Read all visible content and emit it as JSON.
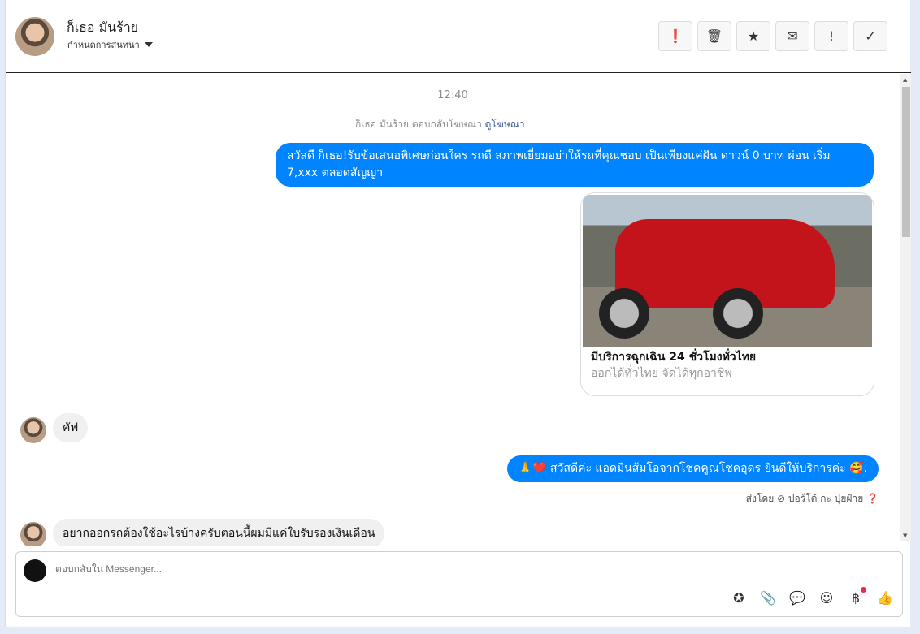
{
  "header": {
    "name": "ก็เธอ มันร้าย",
    "subtitle": "กำหนดการสนทนา",
    "actions": [
      {
        "icon": "alert-circle-icon",
        "glyph": "❗"
      },
      {
        "icon": "trash-icon",
        "glyph": "🗑"
      },
      {
        "icon": "star-icon",
        "glyph": "★"
      },
      {
        "icon": "mail-icon",
        "glyph": "✉"
      },
      {
        "icon": "exclamation-icon",
        "glyph": "!"
      },
      {
        "icon": "check-icon",
        "glyph": "✓"
      }
    ]
  },
  "chat": {
    "time": "12:40",
    "ad_reply": "ก็เธอ มันร้าย ตอบกลับโฆษณา",
    "view_ad": "ดูโฆษณา",
    "msg1": "สวัสดี ก็เธอ!รับข้อเสนอพิเศษก่อนใคร รถดี สภาพเยี่ยมอย่าให้รถที่คุณชอบ เป็นเพียงแค่ฝัน ดาวน์ 0 บาท ผ่อน เริ่ม 7,xxx ตลอดสัญญา",
    "card_title": "มีบริการฉุกเฉิน 24 ชั่วโมงทั่วไทย",
    "card_subtitle": "ออกได้ทั่วไทย จัดได้ทุกอาชีพ",
    "in1": "คัฟ",
    "msg2": "🙏❤️ สวัสดีค่ะ แอดมินส้มโอจากโชคคูณโชคอุดร ยินดีให้บริการค่ะ 🥰.",
    "sent_by": "ส่งโดย ⊘ ปอร์โต้ กะ ปุยฝ้าย ❓",
    "in2": "อยากออกรถต้องใช้อะไรบ้างครับตอนนี้ผมมีแค่ใบรับรองเงินเดือน"
  },
  "composer": {
    "placeholder": "ตอบกลับใน Messenger...",
    "tools": [
      {
        "icon": "saved-reply-icon",
        "glyph": "✪"
      },
      {
        "icon": "attachment-icon",
        "glyph": "📎"
      },
      {
        "icon": "chat-bubble-icon",
        "glyph": "💬"
      },
      {
        "icon": "emoji-icon",
        "glyph": "☺"
      },
      {
        "icon": "baht-icon",
        "glyph": "฿"
      },
      {
        "icon": "like-icon",
        "glyph": "👍"
      }
    ]
  },
  "colors": {
    "accent": "#0084ff"
  }
}
